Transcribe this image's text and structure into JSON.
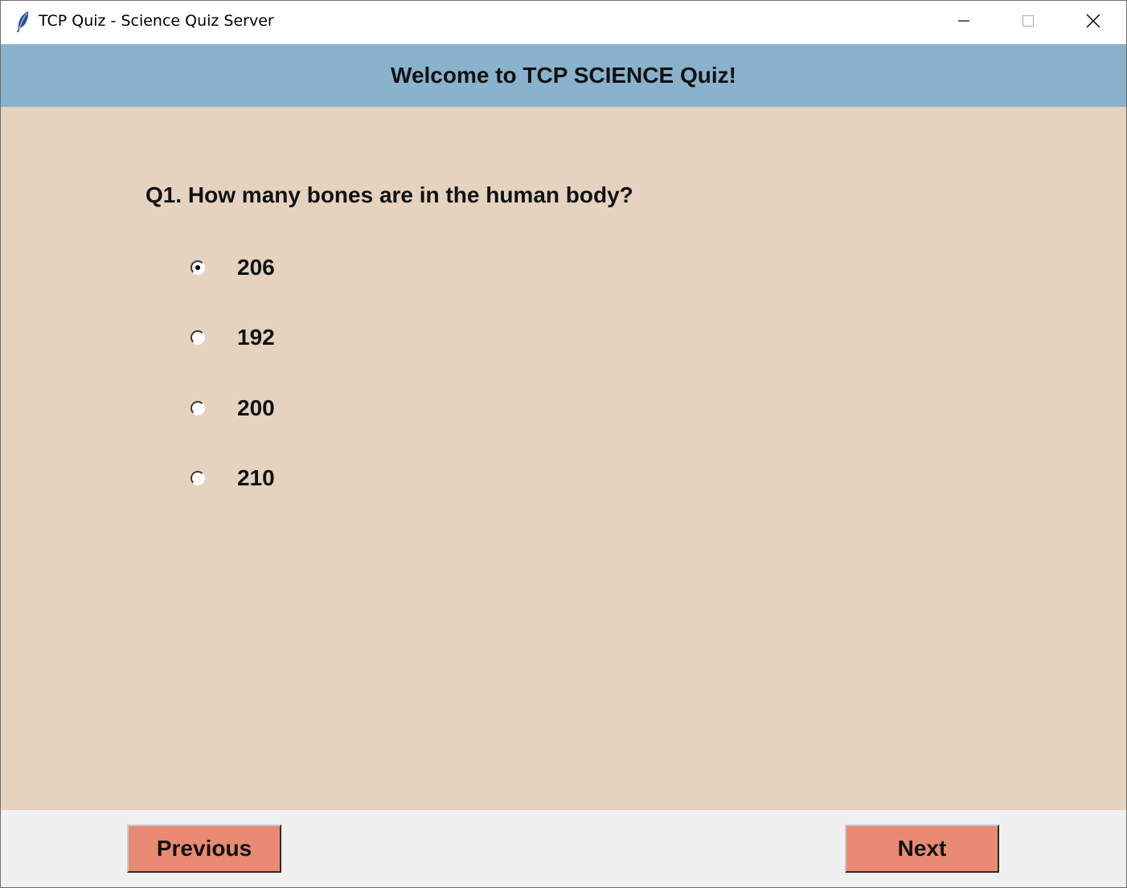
{
  "window": {
    "title": "TCP Quiz - Science Quiz Server",
    "app_icon": "feather-icon",
    "controls": [
      "minimize-icon",
      "maximize-icon",
      "close-icon"
    ]
  },
  "header": {
    "title": "Welcome to TCP SCIENCE Quiz!"
  },
  "quiz": {
    "question": "Q1. How many bones are in the human body?",
    "options": [
      {
        "label": "206",
        "selected": true
      },
      {
        "label": "192",
        "selected": false
      },
      {
        "label": "200",
        "selected": false
      },
      {
        "label": "210",
        "selected": false
      }
    ]
  },
  "footer": {
    "previous_label": "Previous",
    "next_label": "Next"
  },
  "colors": {
    "header_background": "#89b2cc",
    "content_background": "#e5d3c0",
    "button_background": "#e98a74",
    "footer_background": "#f0f0f0"
  }
}
